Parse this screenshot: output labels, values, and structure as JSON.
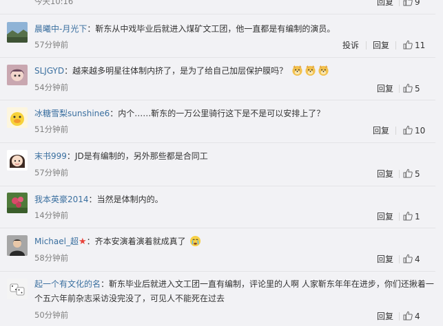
{
  "colors": {
    "username": "#eb7350",
    "text": "#333333",
    "meta": "#808080",
    "background": "#f2f2f5"
  },
  "top_partial": {
    "time": "今天10:16",
    "reply": "回复",
    "likes": "9"
  },
  "comments": [
    {
      "username": "晨曦中-月光下",
      "colon": "：",
      "text": "靳东从中戏毕业后就进入煤矿文工团，他一直都是有编制的演员。",
      "time": "57分钟前",
      "report": "投诉",
      "reply": "回复",
      "likes": "11",
      "avatar": "landscape-avatar"
    },
    {
      "username": "SLJGYD",
      "colon": "：",
      "text": "越来越多明星往体制内挤了，是为了给自己加层保护膜吗？",
      "emojis": [
        "doge-emoji",
        "doge-emoji",
        "doge-emoji"
      ],
      "time": "54分钟前",
      "reply": "回复",
      "likes": "5",
      "avatar": "anime-avatar"
    },
    {
      "username": "冰糖雪梨sunshine6",
      "colon": "：",
      "text": "内个……靳东的一万公里骑行这下是不是可以安排上了？",
      "time": "51分钟前",
      "reply": "回复",
      "likes": "10",
      "avatar": "duck-avatar"
    },
    {
      "username": "末书999",
      "colon": "：",
      "text": "JD是有编制的，另外那些都是合同工",
      "time": "57分钟前",
      "reply": "回复",
      "likes": "5",
      "avatar": "cartoon-girl-avatar"
    },
    {
      "username": "我本英豪2014",
      "colon": "：",
      "text": "当然是体制内的。",
      "time": "14分钟前",
      "reply": "回复",
      "likes": "1",
      "avatar": "flower-avatar"
    },
    {
      "username": "Michael_超",
      "badge": "★",
      "colon": "：",
      "text": "齐本安演着演着就成真了",
      "emojis": [
        "crying-emoji"
      ],
      "time": "58分钟前",
      "reply": "回复",
      "likes": "4",
      "avatar": "person-avatar"
    },
    {
      "username": "起一个有文化的名",
      "colon": "：",
      "text": "靳东毕业后就进入文工团一直有编制，评论里的人啊 人家靳东年年在进步，你们还揪着一个五六年前杂志采访没完没了，可见人不能死在过去",
      "time": "50分钟前",
      "reply": "回复",
      "likes": "4",
      "avatar": "dice-avatar"
    }
  ]
}
